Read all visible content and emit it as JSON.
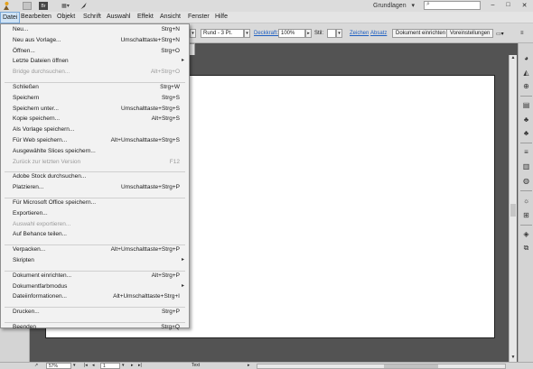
{
  "titlebar": {
    "logo_icon": "adobe-illustrator-logo-icon",
    "br_label": "Br",
    "workspace": "Grundlagen",
    "workspace_arrow": "▾",
    "search_placeholder": "",
    "minimize": "–",
    "maximize": "□",
    "close": "✕"
  },
  "menubar": {
    "items": [
      "Datei",
      "Bearbeiten",
      "Objekt",
      "Schrift",
      "Auswahl",
      "Effekt",
      "Ansicht",
      "Fenster",
      "Hilfe"
    ]
  },
  "controlbar": {
    "stroke_profile": "Rund - 3 Pt.",
    "deckkraft": "Deckkraft:",
    "opacity": "100%",
    "stil": "Stil:",
    "zeichen": "Zeichen",
    "absatz": "Absatz",
    "doc_setup": "Dokument einrichten",
    "preferences": "Voreinstellungen"
  },
  "status": {
    "zoom": "57%",
    "page": "1",
    "tool": "Text"
  },
  "file_menu": {
    "items": [
      {
        "label": "Neu...",
        "shortcut": "Strg+N",
        "enabled": true
      },
      {
        "label": "Neu aus Vorlage...",
        "shortcut": "Umschalttaste+Strg+N",
        "enabled": true
      },
      {
        "label": "Öffnen...",
        "shortcut": "Strg+O",
        "enabled": true
      },
      {
        "label": "Letzte Dateien öffnen",
        "shortcut": "",
        "submenu": true,
        "enabled": true
      },
      {
        "label": "Bridge durchsuchen...",
        "shortcut": "Alt+Strg+O",
        "enabled": false
      },
      {
        "separator": true
      },
      {
        "label": "Schließen",
        "shortcut": "Strg+W",
        "enabled": true
      },
      {
        "label": "Speichern",
        "shortcut": "Strg+S",
        "enabled": true
      },
      {
        "label": "Speichern unter...",
        "shortcut": "Umschalttaste+Strg+S",
        "enabled": true
      },
      {
        "label": "Kopie speichern...",
        "shortcut": "Alt+Strg+S",
        "enabled": true
      },
      {
        "label": "Als Vorlage speichern...",
        "shortcut": "",
        "enabled": true
      },
      {
        "label": "Für Web speichern...",
        "shortcut": "Alt+Umschalttaste+Strg+S",
        "enabled": true
      },
      {
        "label": "Ausgewählte Slices speichern...",
        "shortcut": "",
        "enabled": true
      },
      {
        "label": "Zurück zur letzten Version",
        "shortcut": "F12",
        "enabled": false
      },
      {
        "separator": true
      },
      {
        "label": "Adobe Stock durchsuchen...",
        "shortcut": "",
        "enabled": true
      },
      {
        "label": "Platzieren...",
        "shortcut": "Umschalttaste+Strg+P",
        "enabled": true
      },
      {
        "separator": true
      },
      {
        "label": "Für Microsoft Office speichern...",
        "shortcut": "",
        "enabled": true
      },
      {
        "label": "Exportieren...",
        "shortcut": "",
        "enabled": true
      },
      {
        "label": "Auswahl exportieren...",
        "shortcut": "",
        "enabled": false
      },
      {
        "label": "Auf Behance teilen...",
        "shortcut": "",
        "enabled": true
      },
      {
        "separator": true
      },
      {
        "label": "Verpacken...",
        "shortcut": "Alt+Umschalttaste+Strg+P",
        "enabled": true
      },
      {
        "label": "Skripten",
        "shortcut": "",
        "submenu": true,
        "enabled": true
      },
      {
        "separator": true
      },
      {
        "label": "Dokument einrichten...",
        "shortcut": "Alt+Strg+P",
        "enabled": true
      },
      {
        "label": "Dokumentfarbmodus",
        "shortcut": "",
        "submenu": true,
        "enabled": true
      },
      {
        "label": "Dateiinformationen...",
        "shortcut": "Alt+Umschalttaste+Strg+I",
        "enabled": true
      },
      {
        "separator": true
      },
      {
        "label": "Drucken...",
        "shortcut": "Strg+P",
        "enabled": true
      },
      {
        "separator": true
      },
      {
        "label": "Beenden",
        "shortcut": "Strg+Q",
        "enabled": true
      }
    ]
  },
  "colors": {
    "menu_highlight": "#cfe3f5",
    "link": "#1d5fc2",
    "pasteboard": "#535353"
  }
}
